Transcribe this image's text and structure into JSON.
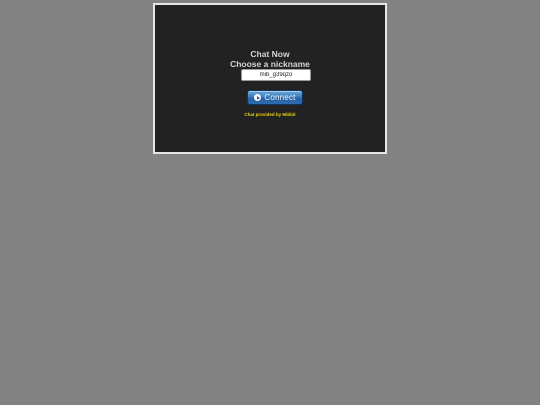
{
  "chat": {
    "title": "Chat Now",
    "subtitle": "Choose a nickname",
    "nickname_value": "mib_g39qzo",
    "connect_label": "Connect",
    "connect_icon": "play-circle-icon",
    "credit": "Chat provided by Mibbit"
  },
  "colors": {
    "page_background": "#828282",
    "panel_background": "#222222",
    "button_accent": "#3f80c0",
    "credit_text": "#e8d410"
  }
}
